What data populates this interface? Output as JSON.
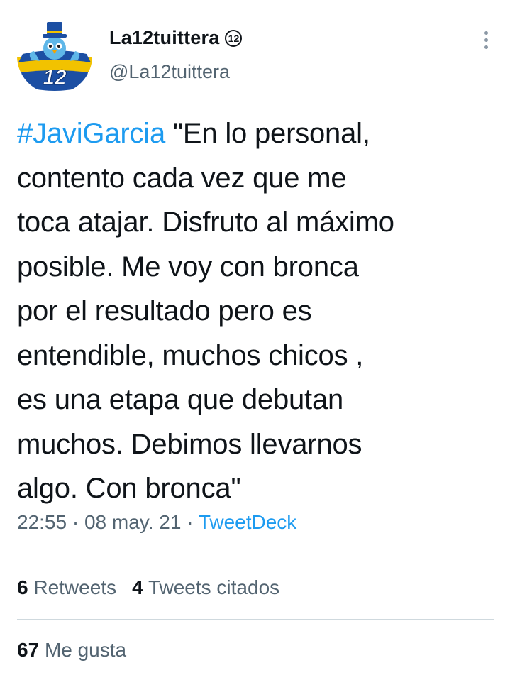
{
  "author": {
    "display_name": "La12tuittera",
    "badge": "12",
    "handle": "@La12tuittera",
    "avatar_text": "12"
  },
  "tweet": {
    "hashtag": "#JaviGarcia",
    "lines": [
      " \"En lo personal,",
      "contento cada vez que me",
      "toca atajar. Disfruto al máximo",
      "posible. Me voy con bronca",
      "por el resultado pero es",
      "entendible, muchos chicos ,",
      "es una etapa que debutan",
      "muchos. Debimos llevarnos",
      "algo. Con bronca\""
    ],
    "time": "22:55",
    "date": "08 may. 21",
    "separator": "·",
    "app": "TweetDeck"
  },
  "stats": {
    "retweets_count": "6",
    "retweets_label": "Retweets",
    "quotes_count": "4",
    "quotes_label": "Tweets citados",
    "likes_count": "67",
    "likes_label": "Me gusta"
  },
  "colors": {
    "link": "#1d9bf0",
    "text": "#0f1419",
    "secondary": "#536471",
    "divider": "#cfd9de"
  },
  "icons": {
    "more": "more-vertical-icon",
    "avatar": "bird-mascot-avatar"
  }
}
